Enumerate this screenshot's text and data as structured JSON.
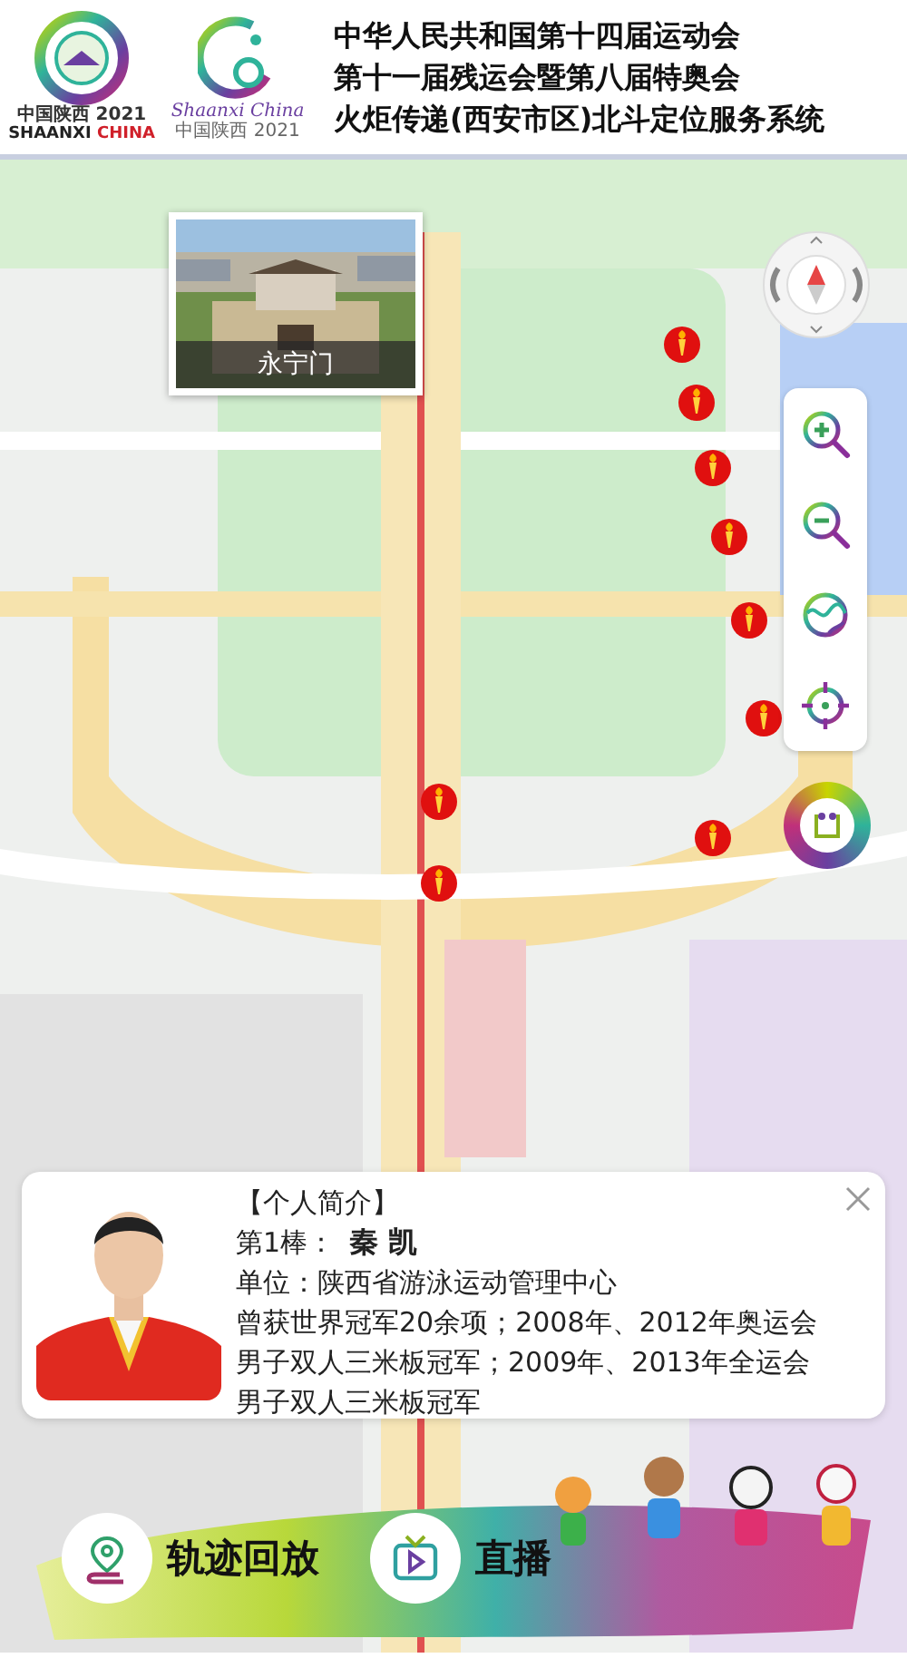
{
  "header": {
    "logo_1": {
      "caption": "中国陕西 2021",
      "wordmark_1": "SHAANXI",
      "wordmark_2": "CHINA"
    },
    "logo_2": {
      "wordmark": "Shaanxi China",
      "caption": "中国陕西 2021"
    },
    "title_lines": [
      "中华人民共和国第十四届运动会",
      "第十一届残运会暨第八届特奥会",
      "火炬传递(西安市区)北斗定位服务系统"
    ]
  },
  "map": {
    "place_popup": {
      "label": "永宁门"
    },
    "controls": [
      {
        "kind": "zoom_in"
      },
      {
        "kind": "zoom_out"
      },
      {
        "kind": "layers"
      },
      {
        "kind": "locate"
      }
    ]
  },
  "profile_card": {
    "heading": "【个人简介】",
    "relay_label": "第1棒：",
    "name": "秦 凯",
    "unit": "单位：陕西省游泳运动管理中心",
    "bio": "曾获世界冠军20余项；2008年、2012年奥运会男子双人三米板冠军；2009年、2013年全运会男子双人三米板冠军"
  },
  "actions": [
    {
      "kind": "track",
      "label": "轨迹回放"
    },
    {
      "kind": "live",
      "label": "直播"
    }
  ]
}
